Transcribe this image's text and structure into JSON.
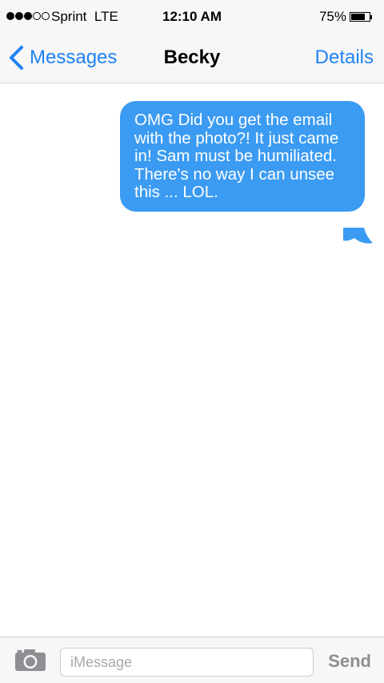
{
  "status_bar": {
    "signal_bars_filled": 3,
    "signal_bars_total": 5,
    "carrier": "Sprint",
    "network": "LTE",
    "time": "12:10 AM",
    "battery_percent": "75%",
    "battery_level": 0.75
  },
  "nav": {
    "back_label": "Messages",
    "title": "Becky",
    "details_label": "Details"
  },
  "messages": [
    {
      "direction": "outgoing",
      "text": "OMG Did you get the email with the photo?! It just came in! Sam must be humiliated. There's no way I can unsee this ... LOL."
    }
  ],
  "composer": {
    "placeholder": "iMessage",
    "value": "",
    "send_label": "Send"
  },
  "colors": {
    "accent": "#1f82f5",
    "bubble": "#3b9bf2",
    "bars": "#f7f7f7",
    "send_disabled": "#8e8e93"
  },
  "icons": {
    "back": "chevron-left-icon",
    "camera": "camera-icon",
    "battery": "battery-icon",
    "signal": "signal-dots-icon"
  }
}
